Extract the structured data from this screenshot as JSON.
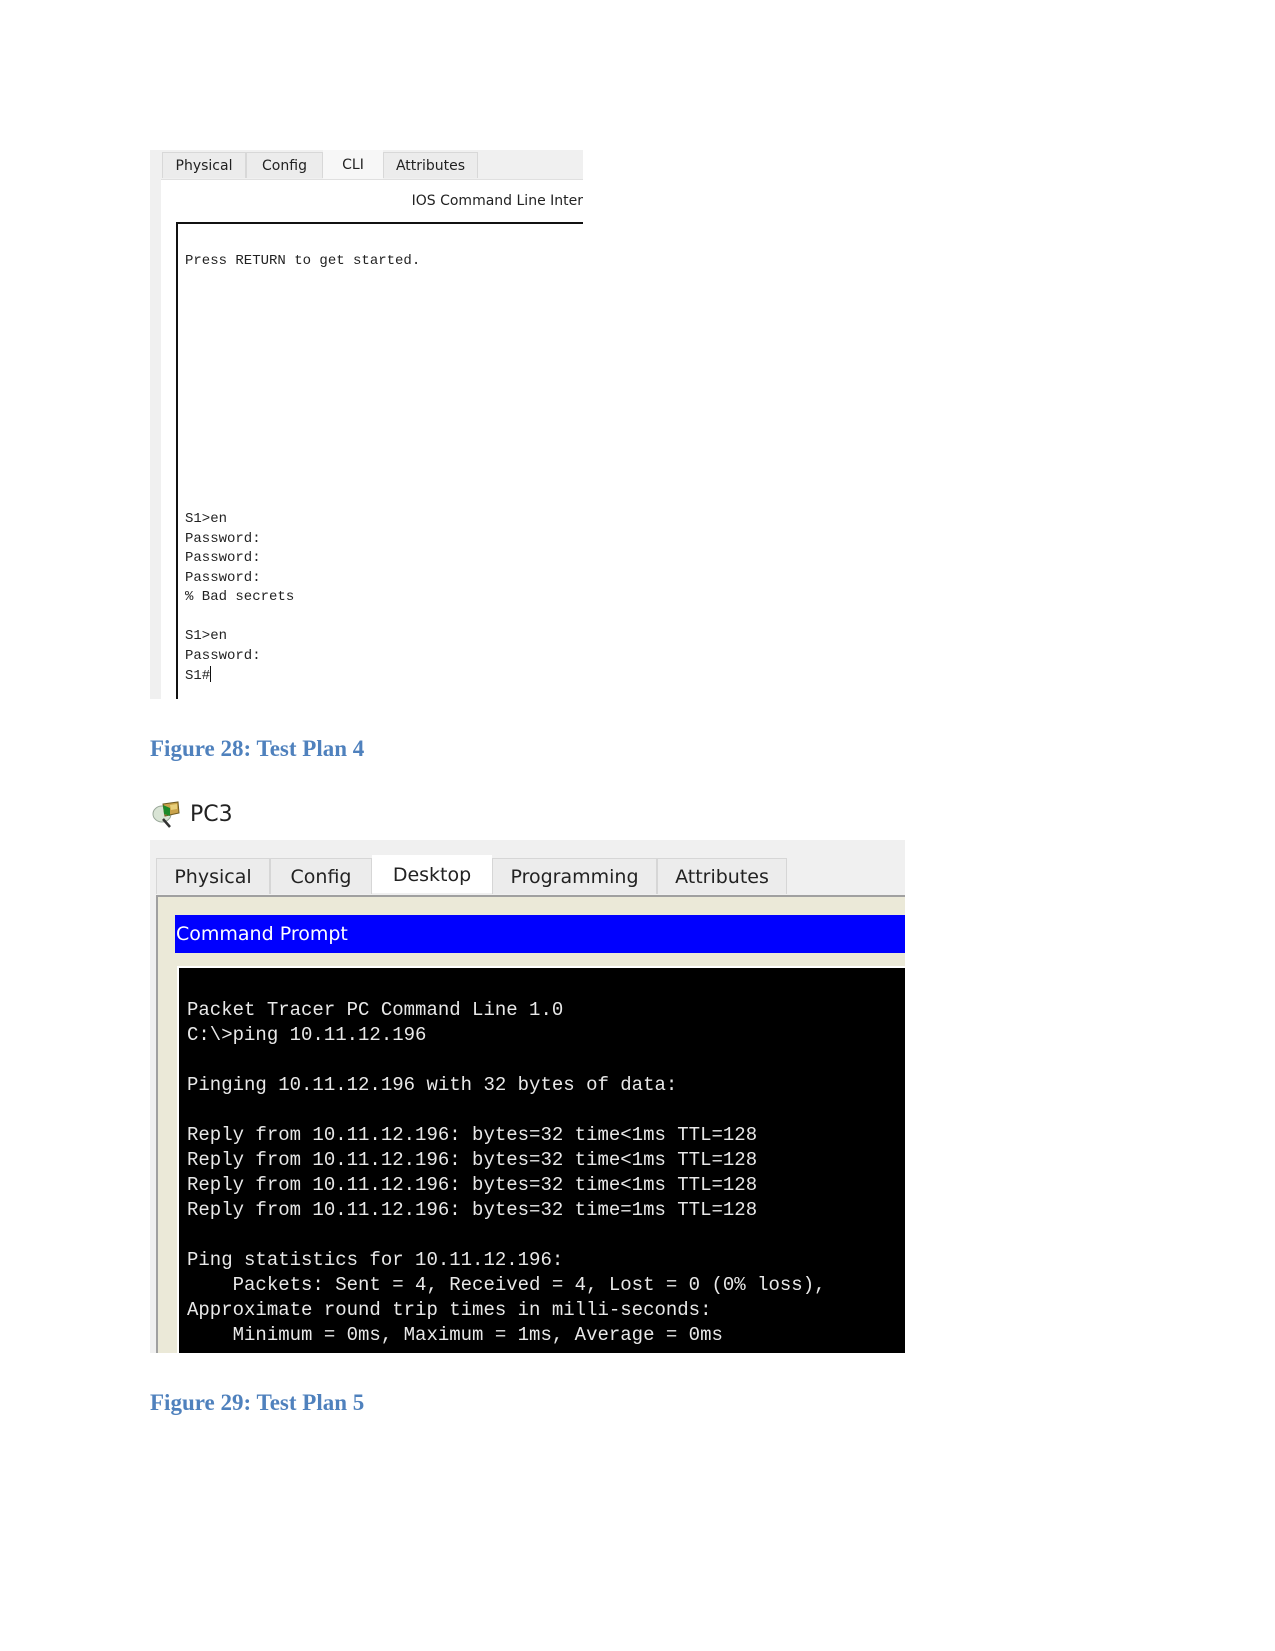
{
  "figure28": {
    "tabs": [
      {
        "label": "Physical",
        "active": false
      },
      {
        "label": "Config",
        "active": false
      },
      {
        "label": "CLI",
        "active": true
      },
      {
        "label": "Attributes",
        "active": false
      }
    ],
    "ios_title": "IOS Command Line Inter",
    "terminal_lines_top": "Press RETURN to get started.",
    "terminal_lines_bottom": "S1>en\nPassword:\nPassword:\nPassword:\n% Bad secrets\n\nS1>en\nPassword:\nS1#",
    "caption": "Figure 28: Test Plan 4"
  },
  "pc3": {
    "icon": "pc-device-icon",
    "label": "PC3"
  },
  "figure29": {
    "tabs": [
      {
        "label": "Physical",
        "active": false
      },
      {
        "label": "Config",
        "active": false
      },
      {
        "label": "Desktop",
        "active": true
      },
      {
        "label": "Programming",
        "active": false
      },
      {
        "label": "Attributes",
        "active": false
      }
    ],
    "window_title": "Command Prompt",
    "terminal_text": "Packet Tracer PC Command Line 1.0\nC:\\>ping 10.11.12.196\n\nPinging 10.11.12.196 with 32 bytes of data:\n\nReply from 10.11.12.196: bytes=32 time<1ms TTL=128\nReply from 10.11.12.196: bytes=32 time<1ms TTL=128\nReply from 10.11.12.196: bytes=32 time<1ms TTL=128\nReply from 10.11.12.196: bytes=32 time=1ms TTL=128\n\nPing statistics for 10.11.12.196:\n    Packets: Sent = 4, Received = 4, Lost = 0 (0% loss),\nApproximate round trip times in milli-seconds:\n    Minimum = 0ms, Maximum = 1ms, Average = 0ms",
    "caption": "Figure 29: Test Plan 5"
  },
  "colors": {
    "caption": "#4f81bd",
    "command_bar": "#0000ff",
    "terminal_bg": "#000000"
  }
}
